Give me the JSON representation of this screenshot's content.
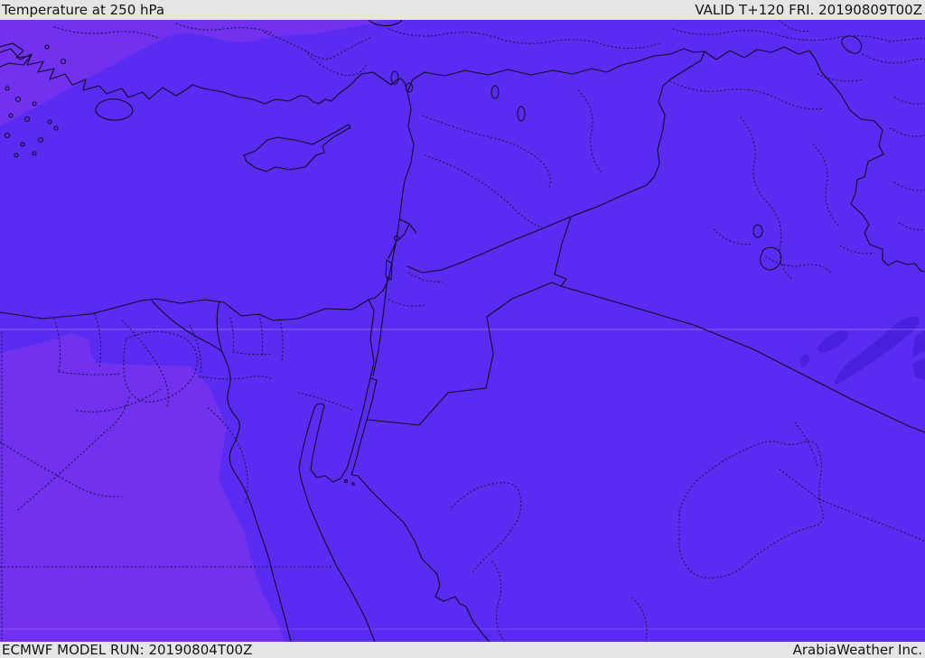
{
  "header": {
    "title": "Temperature at 250 hPa",
    "validity": "VALID T+120 FRI. 20190809T00Z"
  },
  "footer": {
    "model_run": "ECMWF MODEL RUN: 20190804T00Z",
    "credit": "ArabiaWeather Inc."
  },
  "map": {
    "kind": "weather-model-temperature-field",
    "region": "Eastern Mediterranean / Middle East (Turkey, Cyprus, Levant, Egypt, Iraq, Saudi Arabia)",
    "colors": {
      "bar_background": "#e5e5e5",
      "bar_text": "#141414",
      "temp_base_violet": "#5a2bf0",
      "temp_warmer_band_violet": "#7131ee",
      "temp_cooler_band_violet": "#4a20df",
      "coastline_border": "#0d0d28",
      "admin_dotted": "#16163a",
      "graticule_faint_white": "rgba(255,255,255,0.28)"
    }
  }
}
